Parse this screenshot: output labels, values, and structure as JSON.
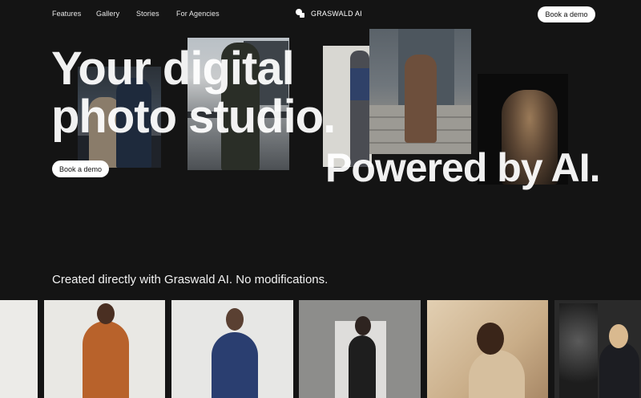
{
  "nav": {
    "links": [
      "Features",
      "Gallery",
      "Stories",
      "For Agencies"
    ],
    "brand": "GRASWALD AI",
    "cta": "Book a demo"
  },
  "hero": {
    "line1": "Your digital",
    "line2": "photo studio.",
    "line3": "Powered by AI.",
    "cta": "Book a demo"
  },
  "gallery": {
    "caption": "Created directly with Graswald AI. No modifications."
  },
  "colors": {
    "background": "#141414",
    "button_bg": "#ffffff",
    "button_text": "#111111"
  }
}
